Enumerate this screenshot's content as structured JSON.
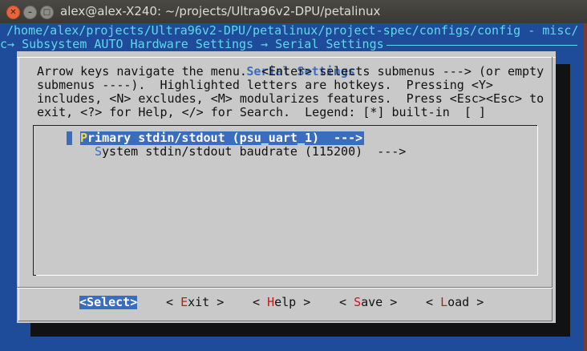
{
  "window": {
    "title": "alex@alex-X240: ~/projects/Ultra96v2-DPU/petalinux",
    "close_glyph": "✕",
    "min_glyph": "–",
    "max_glyph": "□"
  },
  "terminal": {
    "config_path": "/home/alex/projects/Ultra96v2-DPU/petalinux/project-spec/configs/config - misc/",
    "breadcrumb": "c→ Subsystem AUTO Hardware Settings → Serial Settings "
  },
  "dialog": {
    "title": "Serial Settings",
    "help_text": "Arrow keys navigate the menu.  <Enter> selects submenus ---> (or empty\nsubmenus ----).  Highlighted letters are hotkeys.  Pressing <Y>\nincludes, <N> excludes, <M> modularizes features.  Press <Esc><Esc> to\nexit, <?> for Help, </> for Search.  Legend: [*] built-in  [ ]",
    "menu_items": [
      {
        "hotkey": "P",
        "rest": "rimary stdin/stdout (psu_uart_1)  --->",
        "selected": true
      },
      {
        "hotkey": "S",
        "rest": "ystem stdin/stdout baudrate (115200)  --->",
        "selected": false
      }
    ],
    "buttons": {
      "select": {
        "pre": "<",
        "hotkey": "S",
        "rest": "elect>"
      },
      "exit": {
        "pre": "< ",
        "hotkey": "E",
        "rest": "xit >"
      },
      "help": {
        "pre": "< ",
        "hotkey": "H",
        "rest": "elp >"
      },
      "save": {
        "pre": "< ",
        "hotkey": "S",
        "rest": "ave >"
      },
      "load": {
        "pre": "< ",
        "hotkey": "L",
        "rest": "oad >"
      }
    }
  },
  "colors": {
    "terminal_bg": "#1f4c9a",
    "dialog_bg": "#c9c9c9",
    "selection_bg": "#3b6dbf",
    "hotkey_red": "#c11b17",
    "path_cyan": "#5fd8ea"
  }
}
